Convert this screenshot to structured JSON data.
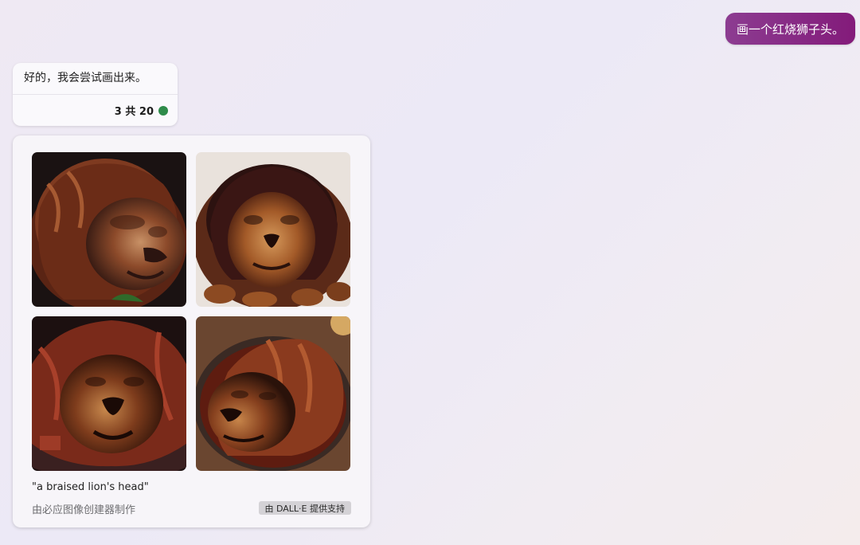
{
  "user_message": {
    "text": "画一个红烧狮子头。",
    "colors": {
      "start": "#8c3c91",
      "end": "#831b7a"
    }
  },
  "bot_message": {
    "text": "好的，我会尝试画出来。",
    "turn_counter": "3 共 20",
    "status_color": "#2e8b4a"
  },
  "image_result": {
    "images": [
      {
        "icon": "braised-lion-head-image-1"
      },
      {
        "icon": "braised-lion-head-image-2"
      },
      {
        "icon": "braised-lion-head-image-3"
      },
      {
        "icon": "braised-lion-head-image-4"
      }
    ],
    "prompt": "\"a braised lion's head\"",
    "credit": "由必应图像创建器制作",
    "powered_by": "由 DALL·E 提供支持"
  }
}
